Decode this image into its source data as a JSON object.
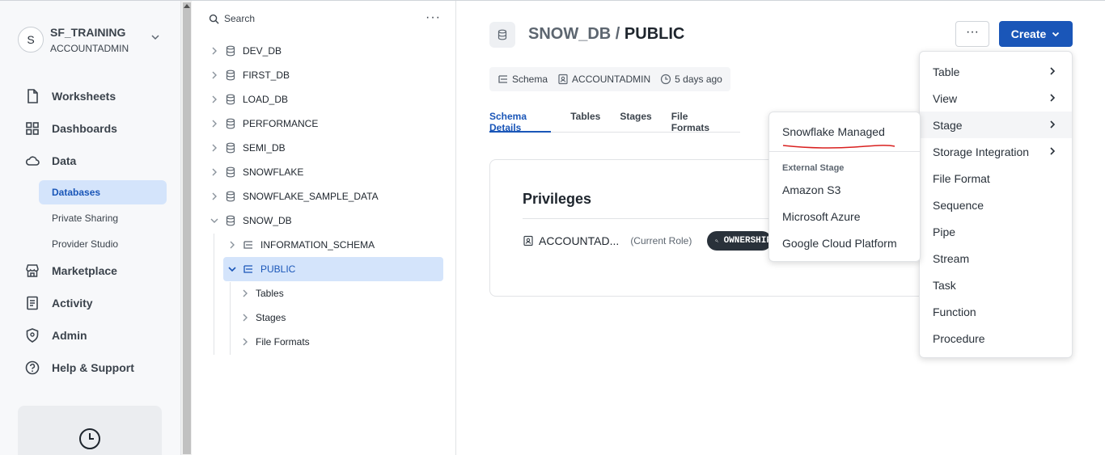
{
  "account": {
    "avatar_letter": "S",
    "name": "SF_TRAINING",
    "role": "ACCOUNTADMIN"
  },
  "nav": {
    "items": [
      {
        "label": "Worksheets",
        "icon": "file-icon"
      },
      {
        "label": "Dashboards",
        "icon": "grid-icon"
      },
      {
        "label": "Data",
        "icon": "cloud-icon"
      },
      {
        "label": "Marketplace",
        "icon": "store-icon"
      },
      {
        "label": "Activity",
        "icon": "activity-icon"
      },
      {
        "label": "Admin",
        "icon": "shield-icon"
      },
      {
        "label": "Help & Support",
        "icon": "help-icon"
      }
    ],
    "data_sub": [
      "Databases",
      "Private Sharing",
      "Provider Studio"
    ]
  },
  "tree": {
    "search_label": "Search",
    "more_label": "···",
    "databases": [
      "DEV_DB",
      "FIRST_DB",
      "LOAD_DB",
      "PERFORMANCE",
      "SEMI_DB",
      "SNOWFLAKE",
      "SNOWFLAKE_SAMPLE_DATA",
      "SNOW_DB"
    ],
    "schemas": [
      "INFORMATION_SCHEMA",
      "PUBLIC"
    ],
    "children": [
      "Tables",
      "Stages",
      "File Formats"
    ]
  },
  "header": {
    "db": "SNOW_DB",
    "sep": " / ",
    "schema": "PUBLIC",
    "more_label": "···",
    "create_label": "Create"
  },
  "meta": {
    "type": "Schema",
    "owner": "ACCOUNTADMIN",
    "updated": "5 days ago"
  },
  "tabs": [
    "Schema Details",
    "Tables",
    "Stages",
    "File Formats"
  ],
  "privileges": {
    "title": "Privileges",
    "role": "ACCOUNTAD...",
    "current": "(Current Role)",
    "badge": "OWNERSHIP"
  },
  "create_menu": [
    "Table",
    "View",
    "Stage",
    "Storage Integration",
    "File Format",
    "Sequence",
    "Pipe",
    "Stream",
    "Task",
    "Function",
    "Procedure"
  ],
  "stage_menu": {
    "managed": "Snowflake Managed",
    "external_header": "External Stage",
    "external": [
      "Amazon S3",
      "Microsoft Azure",
      "Google Cloud Platform"
    ]
  },
  "colors": {
    "accent": "#1a56b8",
    "selected_bg": "#d4e4fb",
    "annotation": "#d9201f"
  }
}
